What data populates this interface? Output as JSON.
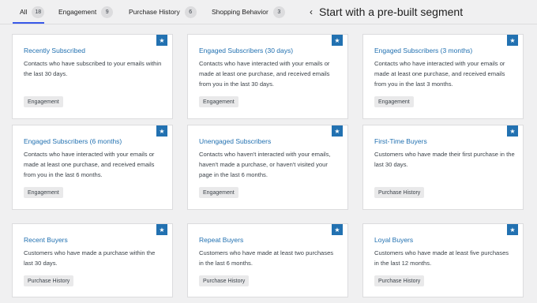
{
  "tabs": [
    {
      "label": "All",
      "count": "18"
    },
    {
      "label": "Engagement",
      "count": "9"
    },
    {
      "label": "Purchase History",
      "count": "6"
    },
    {
      "label": "Shopping Behavior",
      "count": "3"
    }
  ],
  "back": {
    "chevron": "‹",
    "title": "Start with a pre-built segment"
  },
  "star_icon": "★",
  "colors": {
    "accent": "#2271b1",
    "tab_active": "#3858e9",
    "background": "#f0f0f1"
  },
  "cards": [
    {
      "title": "Recently Subscribed",
      "description": "Contacts who have subscribed to your emails within the last 30 days.",
      "tag": "Engagement"
    },
    {
      "title": "Engaged Subscribers (30 days)",
      "description": "Contacts who have interacted with your emails or made at least one purchase, and received emails from you in the last 30 days.",
      "tag": "Engagement"
    },
    {
      "title": "Engaged Subscribers (3 months)",
      "description": "Contacts who have interacted with your emails or made at least one purchase, and received emails from you in the last 3 months.",
      "tag": "Engagement"
    },
    {
      "title": "Engaged Subscribers (6 months)",
      "description": "Contacts who have interacted with your emails or made at least one purchase, and received emails from you in the last 6 months.",
      "tag": "Engagement"
    },
    {
      "title": "Unengaged Subscribers",
      "description": "Contacts who haven't interacted with your emails, haven't made a purchase, or haven't visited your page in the last 6 months.",
      "tag": "Engagement"
    },
    {
      "title": "First-Time Buyers",
      "description": "Customers who have made their first purchase in the last 30 days.",
      "tag": "Purchase History"
    },
    {
      "title": "Recent Buyers",
      "description": "Customers who have made a purchase within the last 30 days.",
      "tag": "Purchase History"
    },
    {
      "title": "Repeat Buyers",
      "description": "Customers who have made at least two purchases in the last 6 months.",
      "tag": "Purchase History"
    },
    {
      "title": "Loyal Buyers",
      "description": "Customers who have made at least five purchases in the last 12 months.",
      "tag": "Purchase History"
    }
  ]
}
